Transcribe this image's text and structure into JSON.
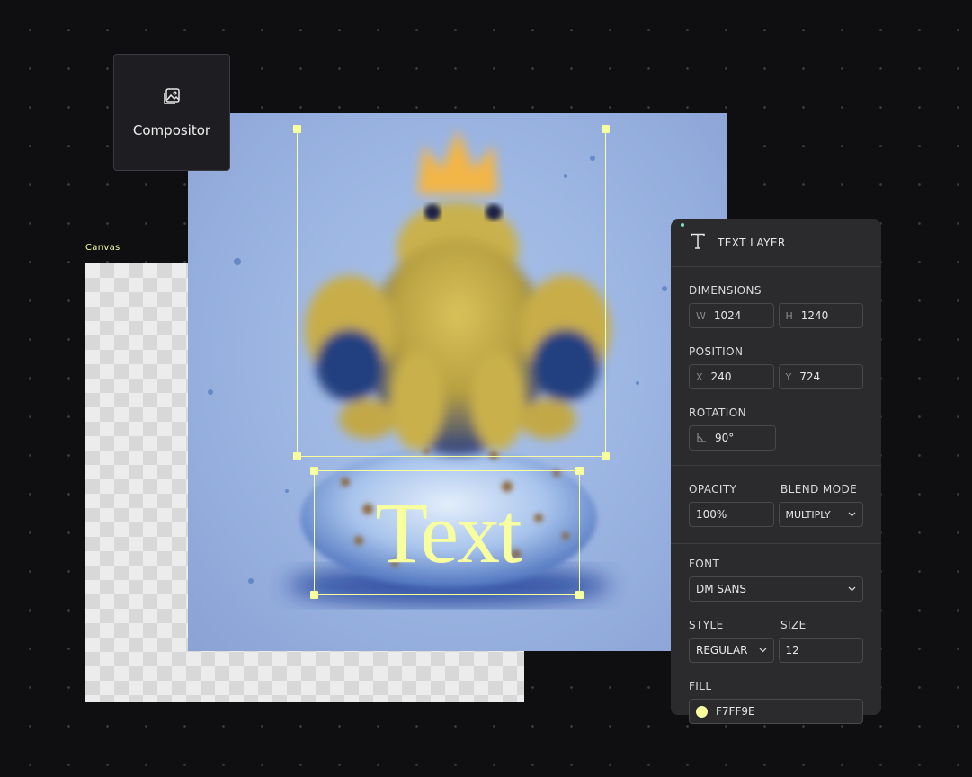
{
  "compositor": {
    "label": "Compositor",
    "icon": "image-stack-icon"
  },
  "canvas": {
    "label": "Canvas"
  },
  "artwork": {
    "text": "Text"
  },
  "panel": {
    "title": "TEXT LAYER",
    "icon": "text-t-icon",
    "dimensions": {
      "label": "DIMENSIONS",
      "w_prefix": "W",
      "w": "1024",
      "h_prefix": "H",
      "h": "1240"
    },
    "position": {
      "label": "POSITION",
      "x_prefix": "X",
      "x": "240",
      "y_prefix": "Y",
      "y": "724"
    },
    "rotation": {
      "label": "ROTATION",
      "value": "90°",
      "icon": "angle-icon"
    },
    "opacity": {
      "label": "OPACITY",
      "value": "100%"
    },
    "blend_mode": {
      "label": "BLEND MODE",
      "value": "MULTIPLY"
    },
    "font": {
      "label": "FONT",
      "value": "DM SANS"
    },
    "style": {
      "label": "STYLE",
      "value": "REGULAR"
    },
    "size": {
      "label": "SIZE",
      "value": "12"
    },
    "fill": {
      "label": "FILL",
      "value": "F7FF9E",
      "color": "#F7FF9E"
    }
  },
  "colors": {
    "accent": "#F7FF9E",
    "background": "#0F0F12",
    "panel": "#2B2B2E"
  }
}
